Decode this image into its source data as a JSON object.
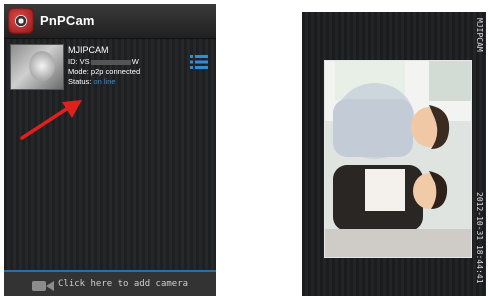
{
  "app": {
    "title": "PnPCam"
  },
  "camera": {
    "name": "MJIPCAM",
    "id_prefix": "ID: VS",
    "id_suffix": "W",
    "mode": "Mode: p2p connected",
    "status_label": "Status: ",
    "status_value": "on line"
  },
  "bottom": {
    "add_camera_label": "Click here to add camera"
  },
  "viewer": {
    "camera_name": "MJIPCAM",
    "timestamp": "2012-10-31 18:44:41"
  },
  "icons": {
    "logo": "camera-logo-icon",
    "menu": "list-menu-icon",
    "add_camera": "camera-icon",
    "annotation": "red-arrow"
  },
  "colors": {
    "status_online": "#2f8fd4",
    "menu_icon": "#2f8fd4",
    "arrow": "#e0201c"
  }
}
